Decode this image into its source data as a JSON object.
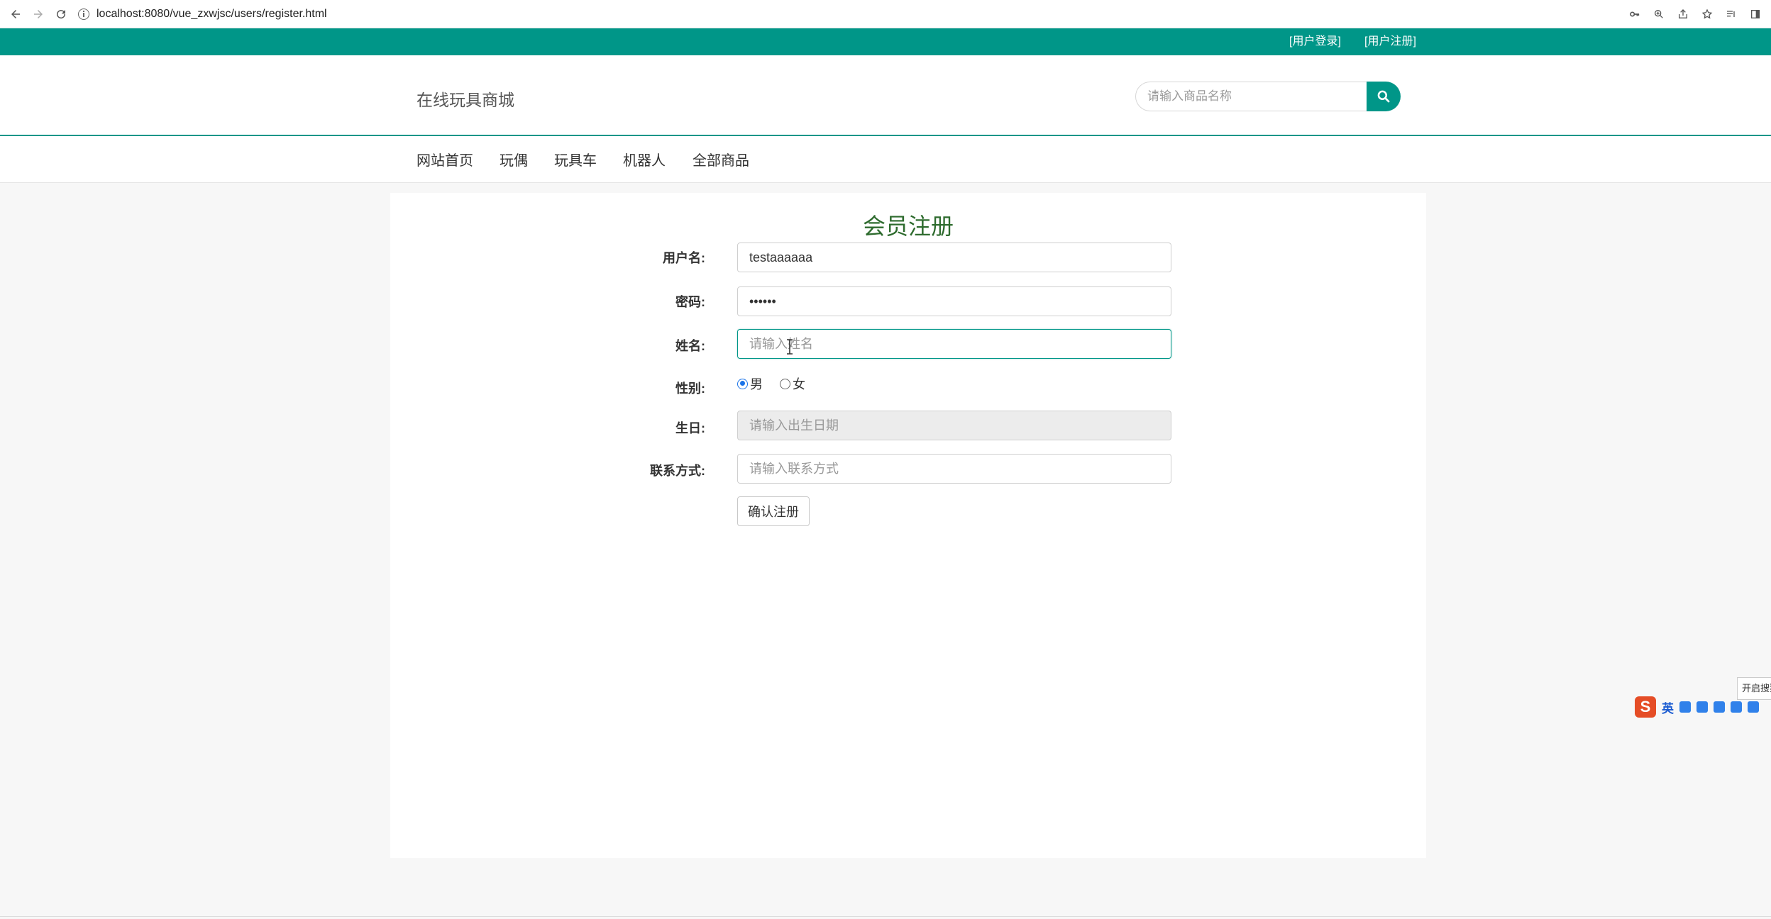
{
  "browser": {
    "url": "localhost:8080/vue_zxwjsc/users/register.html"
  },
  "topbar": {
    "login_link": "[用户登录]",
    "register_link": "[用户注册]"
  },
  "header": {
    "logo": "在线玩具商城",
    "search_placeholder": "请输入商品名称"
  },
  "nav": {
    "items": [
      "网站首页",
      "玩偶",
      "玩具车",
      "机器人",
      "全部商品"
    ]
  },
  "form": {
    "title": "会员注册",
    "username": {
      "label": "用户名:",
      "value": "testaaaaaa"
    },
    "password": {
      "label": "密码:",
      "value": "••••••"
    },
    "name": {
      "label": "姓名:",
      "placeholder": "请输入姓名"
    },
    "gender": {
      "label": "性别:",
      "options": [
        "男",
        "女"
      ],
      "selected": "男"
    },
    "birthday": {
      "label": "生日:",
      "placeholder": "请输入出生日期"
    },
    "contact": {
      "label": "联系方式:",
      "placeholder": "请输入联系方式"
    },
    "submit_label": "确认注册"
  },
  "ime": {
    "logo": "S",
    "mode": "英",
    "tooltip": "开启搜狗"
  },
  "colors": {
    "primary": "#009688",
    "title": "#2e6b2e"
  }
}
